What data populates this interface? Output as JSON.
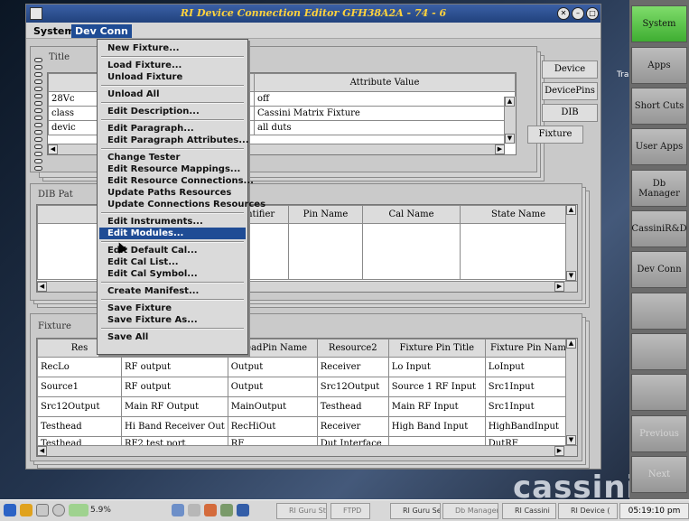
{
  "window": {
    "title": "RI Device Connection Editor GFH38A2A - 74 - 6",
    "menu": {
      "system": "System",
      "dev_conn": "Dev Conn"
    }
  },
  "dropdown": [
    {
      "label": "New Fixture...",
      "sep_after": true
    },
    {
      "label": "Load Fixture..."
    },
    {
      "label": "Unload Fixture",
      "sep_after": true
    },
    {
      "label": "Unload All",
      "sep_after": true
    },
    {
      "label": "Edit Description...",
      "sep_after": true
    },
    {
      "label": "Edit Paragraph..."
    },
    {
      "label": "Edit Paragraph Attributes...",
      "sep_after": true
    },
    {
      "label": "Change Tester"
    },
    {
      "label": "Edit Resource Mappings..."
    },
    {
      "label": "Edit Resource Connections..."
    },
    {
      "label": "Update Paths Resources"
    },
    {
      "label": "Update Connections Resources",
      "sep_after": true
    },
    {
      "label": "Edit Instruments..."
    },
    {
      "label": "Edit Modules...",
      "highlighted": true,
      "sep_after": true
    },
    {
      "label": "Edit Default Cal..."
    },
    {
      "label": "Edit Cal List..."
    },
    {
      "label": "Edit Cal Symbol...",
      "sep_after": true
    },
    {
      "label": "Create Manifest...",
      "sep_after": true
    },
    {
      "label": "Save Fixture"
    },
    {
      "label": "Save Fixture As...",
      "sep_after": true
    },
    {
      "label": "Save All"
    }
  ],
  "title_panel": {
    "label": "Title",
    "header": "Attribute Value",
    "rows": [
      {
        "name": "28Vc",
        "value": "off"
      },
      {
        "name": "class",
        "value": "Cassini Matrix Fixture"
      },
      {
        "name": "devic",
        "value": "all duts"
      }
    ],
    "tabs": [
      "Device",
      "DevicePins",
      "DIB",
      "Fixture"
    ]
  },
  "dib_panel": {
    "label": "DIB Pat",
    "headers": [
      "Identifier",
      "Pin Name",
      "Cal Name",
      "State Name"
    ]
  },
  "fixture_panel": {
    "label": "Fixture",
    "headers": [
      "Res",
      "",
      "HeadPin Name",
      "Resource2",
      "Fixture Pin Title",
      "Fixture Pin Name"
    ],
    "rows": [
      [
        "RecLo",
        "RF output",
        "Output",
        "Receiver",
        "Lo Input",
        "LoInput"
      ],
      [
        "Source1",
        "RF output",
        "Output",
        "Src12Output",
        "Source 1 RF Input",
        "Src1Input"
      ],
      [
        "Src12Output",
        "Main RF Output",
        "MainOutput",
        "Testhead",
        "Main RF Input",
        "Src1Input"
      ],
      [
        "Testhead",
        "Hi Band Receiver Out",
        "RecHiOut",
        "Receiver",
        "High Band Input",
        "HighBandInput"
      ],
      [
        "Testhead",
        "RF2 test port",
        "RF",
        "Dut Interface",
        "",
        "DutRF"
      ]
    ]
  },
  "launcher": [
    "System",
    "Apps",
    "Short Cuts",
    "User Apps",
    "Db Manager",
    "CassiniR&D",
    "Dev Conn",
    "",
    "",
    "",
    "Previous",
    "Next"
  ],
  "desktop": {
    "word": "cassinion",
    "tr": "Tra"
  },
  "taskbar": {
    "cpu": "5.9%",
    "tasks": [
      "RI Guru Str",
      "FTPD",
      "RI Guru Se",
      "Db Manager -",
      "RI Cassini",
      "RI Device ("
    ],
    "clock": "05:19:10 pm"
  }
}
